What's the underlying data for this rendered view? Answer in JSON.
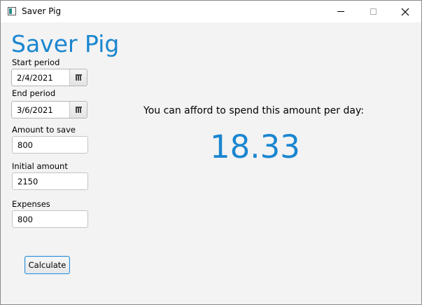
{
  "window": {
    "title": "Saver Pig",
    "icon": "app-window-icon"
  },
  "app": {
    "heading": "Saver Pig",
    "accent_color": "#1a86d0"
  },
  "form": {
    "start_period": {
      "label": "Start period",
      "value": "2/4/2021"
    },
    "end_period": {
      "label": "End period",
      "value": "3/6/2021"
    },
    "amount_to_save": {
      "label": "Amount to save",
      "value": "800"
    },
    "initial_amount": {
      "label": "Initial amount",
      "value": "2150"
    },
    "expenses": {
      "label": "Expenses",
      "value": "800"
    },
    "calculate_label": "Calculate"
  },
  "result": {
    "message": "You can afford to spend this amount per day:",
    "value": "18.33"
  }
}
